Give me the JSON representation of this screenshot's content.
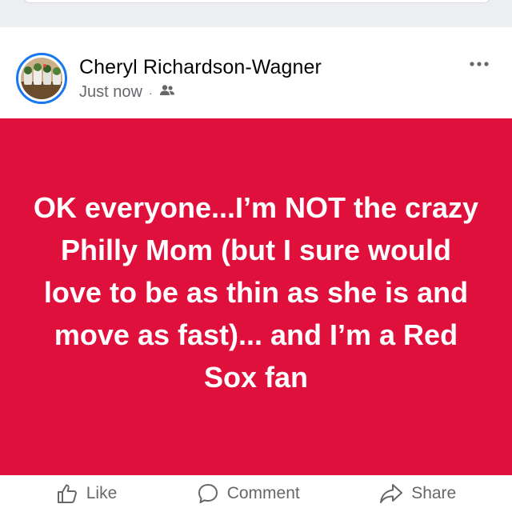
{
  "post": {
    "author": "Cheryl Richardson-Wagner",
    "timestamp": "Just now",
    "separator": "·",
    "audience_icon": "friends-icon",
    "more_icon": "more-options-icon",
    "body_text": "OK everyone...I’m NOT the crazy Philly Mom (but I sure would love to be as thin as she is and move as fast)... and I’m a Red Sox fan",
    "background_color": "#e0103c"
  },
  "actions": {
    "like_label": "Like",
    "comment_label": "Comment",
    "share_label": "Share"
  }
}
